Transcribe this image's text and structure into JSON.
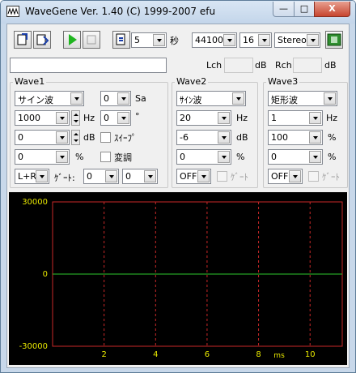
{
  "window": {
    "title": "WaveGene  Ver. 1.40  (C) 1999-2007 efu",
    "min_glyph": "—",
    "max_glyph": "□",
    "close_glyph": "X"
  },
  "toolbar": {
    "duration_value": "5",
    "duration_unit": "秒",
    "sample_rate": "44100",
    "bit_depth": "16",
    "channel_mode": "Stereo"
  },
  "levels": {
    "lch_label": "Lch",
    "lch_unit": "dB",
    "rch_label": "Rch",
    "rch_unit": "dB"
  },
  "wave1": {
    "title": "Wave1",
    "waveform": "サイン波",
    "delay": "0",
    "delay_unit": "Sa",
    "frequency": "1000",
    "freq_unit": "Hz",
    "phase": "0",
    "phase_unit": "°",
    "level": "0",
    "level_unit": "dB",
    "sweep_label": "ｽｲｰﾌﾟ",
    "duty": "0",
    "duty_unit": "%",
    "modulation_label": "変調",
    "output": "L+R",
    "gate_label": "ｹﾞｰﾄ:",
    "gate_on": "0",
    "gate_off": "0"
  },
  "wave2": {
    "title": "Wave2",
    "waveform": "ｻｲﾝ波",
    "frequency": "20",
    "freq_unit": "Hz",
    "level": "-6",
    "level_unit": "dB",
    "duty": "0",
    "duty_unit": "%",
    "output": "OFF",
    "gate_label": "ｹﾞｰﾄ"
  },
  "wave3": {
    "title": "Wave3",
    "waveform": "矩形波",
    "frequency": "1",
    "freq_unit": "Hz",
    "duty": "100",
    "duty_unit": "%",
    "offset": "0",
    "offset_unit": "%",
    "output": "OFF",
    "gate_label": "ｹﾞｰﾄ"
  },
  "colors": {
    "plot_background": "#000000",
    "grid": "#c82828",
    "trace": "#2ec82e",
    "tick_labels": "#e8e800"
  },
  "chart_data": {
    "type": "line",
    "xlabel": "ms",
    "x_ticks": [
      2,
      4,
      6,
      8,
      10
    ],
    "y_ticks": [
      30000,
      0,
      -30000
    ],
    "y_tick_labels": [
      "30000",
      "0",
      "-30000"
    ],
    "xlim": [
      0,
      11.25
    ],
    "ylim": [
      -30000,
      30000
    ],
    "grid": true,
    "series": [
      {
        "x": [
          0,
          11.25
        ],
        "values": [
          0,
          0
        ]
      }
    ]
  }
}
